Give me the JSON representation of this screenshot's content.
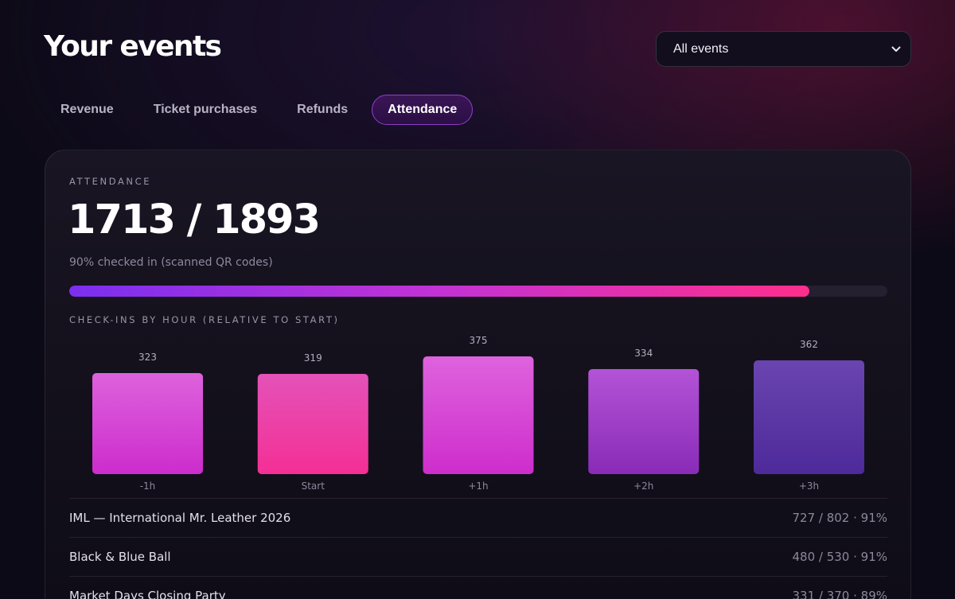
{
  "page": {
    "title": "Your events"
  },
  "filter": {
    "selected": "All events"
  },
  "tabs": [
    {
      "label": "Revenue",
      "active": false
    },
    {
      "label": "Ticket purchases",
      "active": false
    },
    {
      "label": "Refunds",
      "active": false
    },
    {
      "label": "Attendance",
      "active": true
    }
  ],
  "attendance": {
    "eyebrow": "ATTENDANCE",
    "checked_in": 1713,
    "total": 1893,
    "summary": "1713 / 1893",
    "subtext": "90% checked in (scanned QR codes)",
    "progress_fraction": 0.905
  },
  "chart_title": "CHECK-INS BY HOUR (RELATIVE TO START)",
  "chart_data": {
    "type": "bar",
    "categories": [
      "-1h",
      "Start",
      "+1h",
      "+2h",
      "+3h"
    ],
    "values": [
      323,
      319,
      375,
      334,
      362
    ],
    "ylim": [
      0,
      375
    ],
    "grid": false,
    "legend": "none"
  },
  "colors": {
    "accent": "#8e3fc8",
    "progress_start": "#7b2ff0",
    "progress_end": "#ff2f8c",
    "bar_magenta": "#d83fd6",
    "bar_pink": "#f03d9c",
    "bar_purple": "#9a3ac8",
    "bar_indigo": "#5a35a8"
  },
  "events": [
    {
      "name": "IML — International Mr. Leather 2026",
      "stat": "727 / 802 · 91%"
    },
    {
      "name": "Black & Blue Ball",
      "stat": "480 / 530 · 91%"
    },
    {
      "name": "Market Days Closing Party",
      "stat": "331 / 370 · 89%"
    }
  ]
}
